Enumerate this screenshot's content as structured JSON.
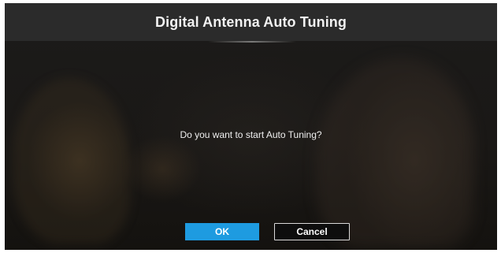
{
  "dialog": {
    "title": "Digital Antenna Auto Tuning",
    "message": "Do you want to start Auto Tuning?"
  },
  "buttons": {
    "ok_label": "OK",
    "cancel_label": "Cancel",
    "focused": "OK"
  },
  "colors": {
    "title_bar": "#2b2b2b",
    "focused_button": "#1e9be0",
    "unfocused_button": "#0d0d0d",
    "text": "#f2f2f2"
  }
}
